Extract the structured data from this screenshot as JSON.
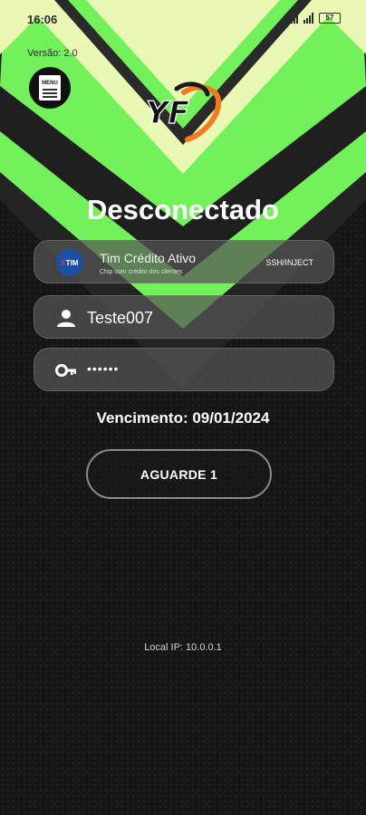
{
  "status_bar": {
    "time": "16:06",
    "battery": "57"
  },
  "app": {
    "version": "Versão: 2.0",
    "menu_label": "MENU",
    "logo_text": "YF"
  },
  "connection": {
    "state": "Desconectado"
  },
  "server": {
    "name": "Tim Crédito Ativo",
    "description": "Chip com crédito dos clientes",
    "mode": "SSH/INJECT",
    "operator_logo": "TIM"
  },
  "login": {
    "username": "Teste007",
    "password": "••••••"
  },
  "account": {
    "expiry": "Vencimento: 09/01/2024"
  },
  "action": {
    "label": "AGUARDE 1"
  },
  "network": {
    "local_ip": "Local IP: 10.0.0.1"
  },
  "colors": {
    "accent_green": "#72f15a",
    "pale_green": "#e9f9b4",
    "dark_stripe": "#2a2a2a",
    "background": "#151515",
    "logo_orange": "#f47a1f"
  },
  "icons": {
    "menu": "menu-icon",
    "user": "user-icon",
    "password": "key-icon",
    "operator": "tim-logo-icon"
  }
}
